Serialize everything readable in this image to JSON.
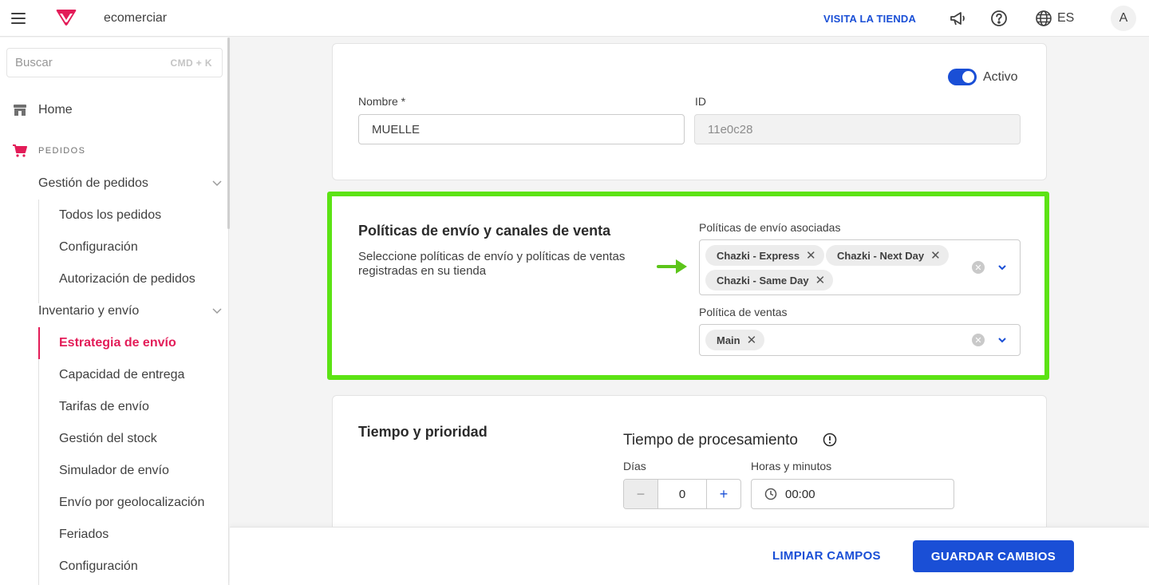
{
  "topbar": {
    "store_name": "ecomerciar",
    "visit_store": "VISITA LA TIENDA",
    "language": "ES",
    "avatar_initial": "A",
    "brand_color": "#e31c58",
    "accent_color": "#1a4fd6"
  },
  "sidebar": {
    "search_placeholder": "Buscar",
    "search_shortcut": "CMD + K",
    "home": "Home",
    "section_orders": "PEDIDOS",
    "group_orders": "Gestión de pedidos",
    "orders_items": [
      "Todos los pedidos",
      "Configuración",
      "Autorización de pedidos"
    ],
    "group_inventory": "Inventario y envío",
    "inventory_items": [
      "Estrategia de envío",
      "Capacidad de entrega",
      "Tarifas de envío",
      "Gestión del stock",
      "Simulador de envío",
      "Envío por geolocalización",
      "Feriados",
      "Configuración"
    ],
    "active_item": "Estrategia de envío"
  },
  "general": {
    "active_label": "Activo",
    "active": true,
    "name_label": "Nombre *",
    "name_value": "MUELLE",
    "id_label": "ID",
    "id_value": "11e0c28"
  },
  "policies": {
    "title": "Políticas de envío y canales de venta",
    "description": "Seleccione políticas de envío y políticas de ventas registradas en su tienda",
    "shipping_label": "Políticas de envío asociadas",
    "shipping_tags": [
      "Chazki - Express",
      "Chazki - Next Day",
      "Chazki - Same Day"
    ],
    "sales_label": "Política de ventas",
    "sales_tags": [
      "Main"
    ],
    "highlight_color": "#5ce314"
  },
  "timing": {
    "title": "Tiempo y prioridad",
    "processing_title": "Tiempo de procesamiento",
    "days_label": "Días",
    "days_value": "0",
    "minus": "−",
    "plus": "+",
    "hours_label": "Horas y minutos",
    "hours_value": "00:00"
  },
  "footer": {
    "clear_label": "LIMPIAR CAMPOS",
    "save_label": "GUARDAR CAMBIOS"
  }
}
